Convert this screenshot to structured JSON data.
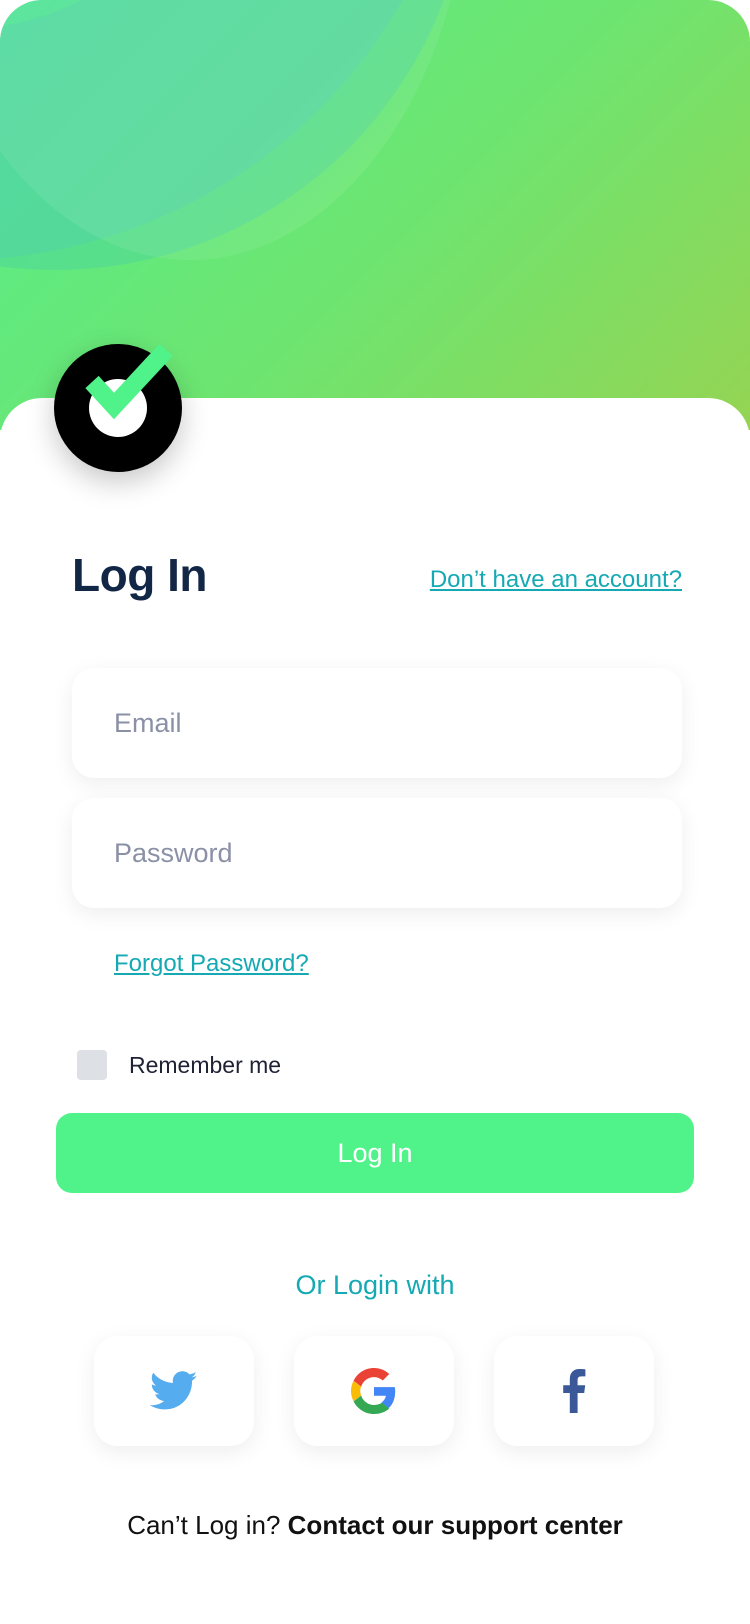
{
  "header": {
    "title": "Log In",
    "signup_link": "Don’t have an account?"
  },
  "form": {
    "email_placeholder": "Email",
    "password_placeholder": "Password",
    "forgot_password": "Forgot Password?",
    "remember_me": "Remember me",
    "login_button": "Log In"
  },
  "social": {
    "label": "Or Login with",
    "providers": [
      {
        "name": "twitter",
        "icon": "twitter-icon",
        "color": "#55acee"
      },
      {
        "name": "google",
        "icon": "google-icon",
        "color": "#4285f4"
      },
      {
        "name": "facebook",
        "icon": "facebook-icon",
        "color": "#3b5998"
      }
    ]
  },
  "footer": {
    "prefix": "Can’t Log in?",
    "contact": "Contact our support center"
  },
  "colors": {
    "accent_green": "#50f38a",
    "link_teal": "#15a9b4",
    "title_navy": "#122646"
  }
}
